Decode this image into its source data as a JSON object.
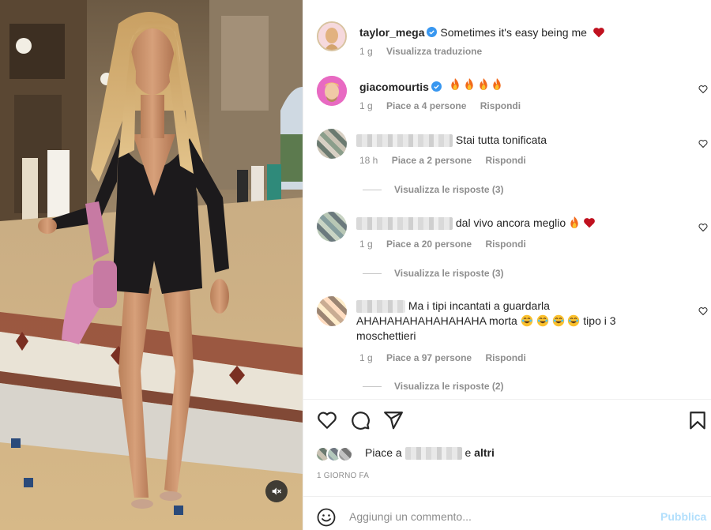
{
  "post": {
    "author": "taylor_mega",
    "caption": "Sometimes it's easy being me",
    "caption_emoji": "heart",
    "time": "1 g",
    "translate_label": "Visualizza traduzione"
  },
  "comments": [
    {
      "username": "giacomourtis",
      "verified": true,
      "text": "",
      "emoji": [
        "fire",
        "fire",
        "fire",
        "fire"
      ],
      "time": "1 g",
      "likes": "Piace a 4 persone",
      "reply": "Rispondi",
      "replies": ""
    },
    {
      "username": "",
      "text": "Stai tutta tonificata",
      "time": "18 h",
      "likes": "Piace a 2 persone",
      "reply": "Rispondi",
      "replies": "Visualizza le risposte (3)"
    },
    {
      "username": "",
      "text": "dal vivo ancora meglio",
      "emoji": [
        "fire",
        "heart"
      ],
      "time": "1 g",
      "likes": "Piace a 20 persone",
      "reply": "Rispondi",
      "replies": "Visualizza le risposte (3)"
    },
    {
      "username": "",
      "text_line1": "Ma i tipi incantati a guardarla",
      "text_line2": "AHAHAHAHAHAHAHAHA morta",
      "text_line2_end": "tipo i 3",
      "text_line3": "moschettieri",
      "emoji": [
        "laugh",
        "laugh",
        "laugh",
        "laugh"
      ],
      "time": "1 g",
      "likes": "Piace a 97 persone",
      "reply": "Rispondi",
      "replies": "Visualizza le risposte (2)"
    }
  ],
  "actions": {
    "like_icon": "heart-outline-icon",
    "comment_icon": "comment-bubble-icon",
    "share_icon": "paper-plane-icon",
    "save_icon": "bookmark-icon"
  },
  "likes_summary": {
    "prefix": "Piace a",
    "suffix": "e",
    "others": "altri"
  },
  "date": "1 GIORNO FA",
  "composer": {
    "emoji_icon": "smiley-icon",
    "placeholder": "Aggiungi un commento...",
    "publish_label": "Pubblica"
  },
  "media": {
    "mute_icon": "speaker-muted-icon"
  },
  "colors": {
    "verified": "#3897f0",
    "link_disabled": "#b2dffc",
    "meta": "#8e8e8e",
    "heart_red": "#ed4956"
  }
}
